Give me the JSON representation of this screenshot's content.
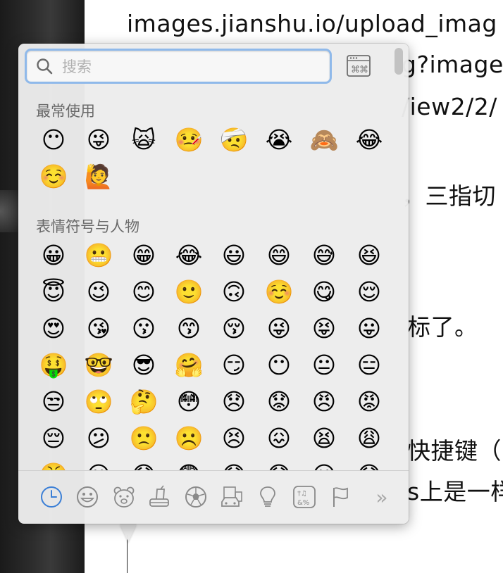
{
  "document": {
    "lines": [
      "images.jianshu.io/upload_imag",
      "g?image",
      "/iew2/2/",
      "，三指切",
      "标了。",
      "快捷键（",
      "s上是一样"
    ]
  },
  "picker": {
    "search": {
      "placeholder": "搜索",
      "value": ""
    },
    "sections": [
      {
        "title": "最常使用",
        "emojis": [
          "😶",
          "😜",
          "🙀",
          "🤒",
          "🤕",
          "😭",
          "🙈",
          "😂",
          "☺️",
          "🙋"
        ]
      },
      {
        "title": "表情符号与人物",
        "emojis": [
          "😀",
          "😬",
          "😁",
          "😂",
          "😃",
          "😄",
          "😅",
          "😆",
          "😇",
          "😉",
          "😊",
          "🙂",
          "🙃",
          "☺️",
          "😋",
          "😌",
          "😍",
          "😘",
          "😗",
          "😙",
          "😚",
          "😜",
          "😝",
          "😛",
          "🤑",
          "🤓",
          "😎",
          "🤗",
          "😏",
          "😶",
          "😐",
          "😑",
          "😒",
          "🙄",
          "🤔",
          "😳",
          "😞",
          "😟",
          "😠",
          "😡",
          "😔",
          "😕",
          "🙁",
          "☹️",
          "😣",
          "😖",
          "😫",
          "😩",
          "😤",
          "😮",
          "😱",
          "😨",
          "😰",
          "😯",
          "😦",
          "😧"
        ]
      }
    ],
    "tabs": [
      {
        "name": "recent",
        "icon": "clock-icon",
        "active": true
      },
      {
        "name": "smileys",
        "icon": "smiley-icon"
      },
      {
        "name": "animals",
        "icon": "bear-icon"
      },
      {
        "name": "food",
        "icon": "food-icon"
      },
      {
        "name": "activity",
        "icon": "soccer-ball-icon"
      },
      {
        "name": "travel",
        "icon": "car-building-icon"
      },
      {
        "name": "objects",
        "icon": "lightbulb-icon"
      },
      {
        "name": "symbols",
        "icon": "symbols-icon"
      },
      {
        "name": "flags",
        "icon": "flag-icon"
      }
    ],
    "more_label": "»",
    "accent_color": "#3b7fd6"
  }
}
